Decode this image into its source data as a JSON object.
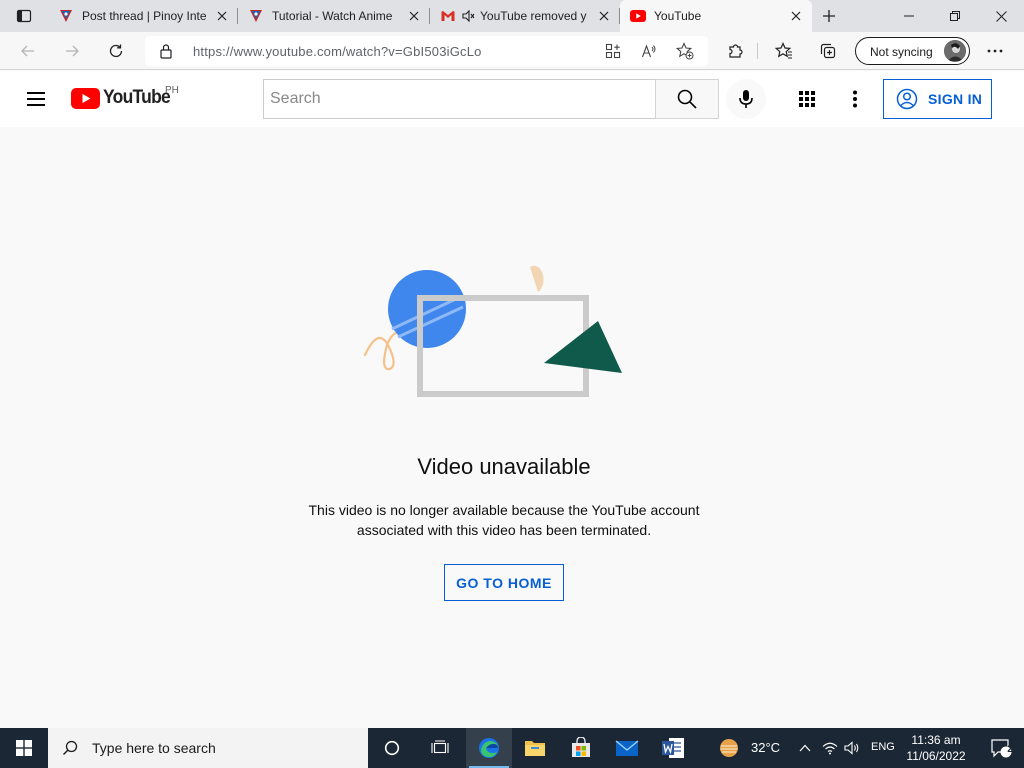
{
  "browser": {
    "tabs": [
      {
        "title": "Post thread | Pinoy Inte",
        "favicon": "pinoy-favicon"
      },
      {
        "title": "Tutorial - Watch Anime",
        "favicon": "pinoy-favicon"
      },
      {
        "title": "YouTube removed y",
        "favicon": "gmail-favicon"
      },
      {
        "title": "YouTube",
        "favicon": "youtube-favicon",
        "active": true
      }
    ],
    "url": "https://www.youtube.com/watch?v=GbI503iGcLo",
    "profile_label": "Not syncing"
  },
  "youtube": {
    "logo_text": "YouTube",
    "country_code": "PH",
    "search_placeholder": "Search",
    "sign_in_label": "SIGN IN",
    "brand_color": "#ff0000",
    "accent_color": "#065fd4"
  },
  "error": {
    "title": "Video unavailable",
    "message_line1": "This video is no longer available because the YouTube account",
    "message_line2": "associated with this video has been terminated.",
    "button_label": "GO TO HOME"
  },
  "taskbar": {
    "search_placeholder": "Type here to search",
    "weather": "32°C",
    "language": "ENG",
    "time": "11:36 am",
    "date": "11/06/2022",
    "notification_count": "2"
  }
}
